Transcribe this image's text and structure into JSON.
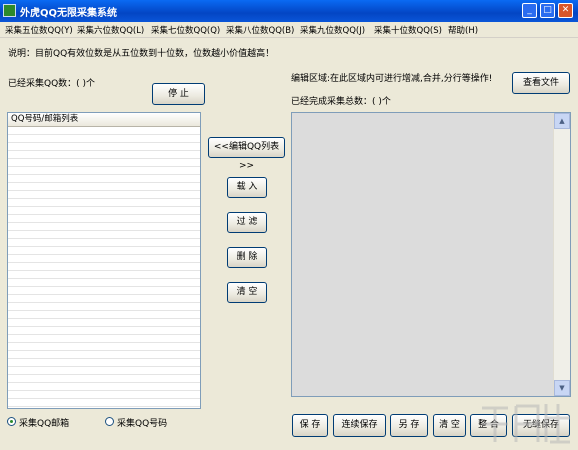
{
  "window": {
    "title": "外虎QQ无限采集系统"
  },
  "menu": [
    "采集五位数QQ(Y)",
    "采集六位数QQ(L)",
    "采集七位数QQ(Q)",
    "采集八位数QQ(B)",
    "采集九位数QQ(J)",
    "采集十位数QQ(S)",
    "帮助(H)"
  ],
  "info": {
    "description": "说明：目前QQ有效位数是从五位数到十位数，位数越小价值越高！",
    "collected": "已经采集QQ数：(    )个",
    "edit_hint": "编辑区域:在此区域内可进行增减,合并,分行等操作!",
    "completed": "已经完成采集总数：(    )个"
  },
  "buttons": {
    "stop": "停 止",
    "view_file": "查看文件",
    "edit_list": "<<编辑QQ列表>>",
    "load": "载 入",
    "filter": "过 滤",
    "delete": "删 除",
    "clear_left": "清 空",
    "save": "保 存",
    "continuous_save": "连续保存",
    "save_as": "另 存",
    "clear": "清 空",
    "merge": "整 合",
    "seamless_save": "无缝保存"
  },
  "list": {
    "header": "QQ号码/邮箱列表"
  },
  "radios": [
    {
      "label": "采集QQ邮箱",
      "selected": true
    },
    {
      "label": "采集QQ号码",
      "selected": false
    }
  ]
}
